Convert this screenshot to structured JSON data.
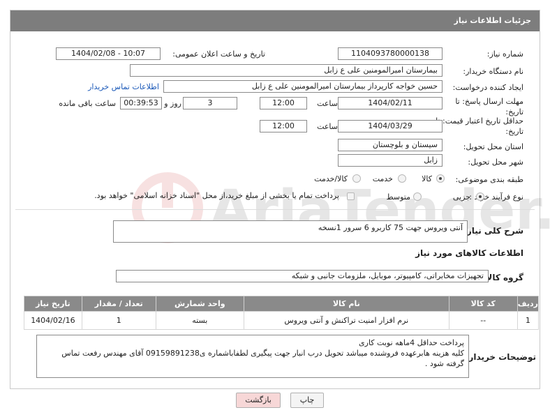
{
  "header": {
    "title": "جزئیات اطلاعات نیاز"
  },
  "fields": {
    "need_number": {
      "label": "شماره نیاز:",
      "value": "1104093780000138"
    },
    "announce": {
      "label": "تاریخ و ساعت اعلان عمومی:",
      "value": "1404/02/08 - 10:07"
    },
    "buyer_org": {
      "label": "نام دستگاه خریدار:",
      "value": "بیمارستان امیرالمومنین علی  ع  زابل"
    },
    "requester": {
      "label": "ایجاد کننده درخواست:",
      "value": "حسین خواجه کارپرداز بیمارستان امیرالمومنین علی  ع  زابل",
      "contact_link": "اطلاعات تماس خریدار"
    },
    "reply_deadline": {
      "label": "مهلت ارسال پاسخ: تا تاریخ:",
      "date": "1404/02/11",
      "time_label": "ساعت",
      "time": "12:00",
      "days": "3",
      "days_label": "روز و",
      "remaining": "00:39:53",
      "remaining_label": "ساعت باقی مانده"
    },
    "price_validity": {
      "label": "حداقل تاریخ اعتبار قیمت: تا تاریخ:",
      "date": "1404/03/29",
      "time_label": "ساعت",
      "time": "12:00"
    },
    "province": {
      "label": "استان محل تحویل:",
      "value": "سیستان و بلوچستان"
    },
    "city": {
      "label": "شهر محل تحویل:",
      "value": "زابل"
    },
    "category": {
      "label": "طبقه بندی موضوعی:",
      "options": [
        "کالا",
        "خدمت",
        "کالا/خدمت"
      ],
      "selected": 0
    },
    "process": {
      "label": "نوع فرآیند خرید :",
      "options": [
        "جزیی",
        "متوسط"
      ],
      "selected": 0,
      "note": "پرداخت تمام یا بخشی از مبلغ خرید،از محل \"اسناد خزانه اسلامی\" خواهد بود."
    }
  },
  "description": {
    "label": "شرح کلی نیاز:",
    "value": "آنتی ویروس جهت 75 کاربرو 6 سرور   1نسخه"
  },
  "goods_section": {
    "title": "اطلاعات کالاهای مورد نیاز"
  },
  "goods_group": {
    "label": "گروه کالا:",
    "value": "تجهیزات مخابراتی، کامپیوتر، موبایل، ملزومات جانبی و شبکه"
  },
  "table": {
    "headers": [
      "ردیف",
      "کد کالا",
      "نام کالا",
      "واحد شمارش",
      "تعداد / مقدار",
      "تاریخ نیاز"
    ],
    "rows": [
      [
        "1",
        "--",
        "نرم افزار امنیت تراکنش و آنتی ویروس",
        "بسته",
        "1",
        "1404/02/16"
      ]
    ]
  },
  "buyer_notes": {
    "label": "توضیحات خریدار:",
    "lines": [
      "پرداخت حداقل 4ماهه نوبت کاری",
      "کلیه هزینه هابرعهده فروشنده میباشد تحویل درب انبار جهت پیگیری لطفاباشماره ی09159891238 آقای مهندس رفعت تماس",
      "گرفته شود ."
    ]
  },
  "buttons": {
    "print": "چاپ",
    "back": "بازگشت"
  },
  "watermark": {
    "text": "AriaTender.neT"
  },
  "colors": {
    "header_bg": "#7d7d7d",
    "link": "#1a58b8",
    "back_btn_bg": "#f7d7d7"
  }
}
